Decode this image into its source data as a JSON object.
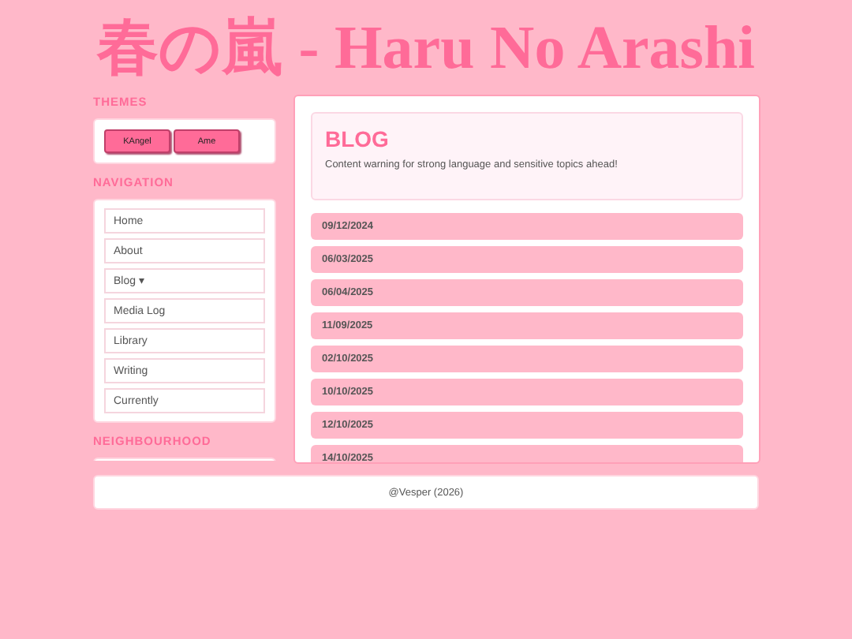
{
  "site_title": "春の嵐 - Haru No Arashi",
  "sidebar": {
    "themes_heading": "THEMES",
    "themes": [
      {
        "label": "KAngel"
      },
      {
        "label": "Ame"
      }
    ],
    "navigation_heading": "NAVIGATION",
    "navigation": [
      {
        "label": "Home"
      },
      {
        "label": "About"
      },
      {
        "label": "Blog ▾"
      },
      {
        "label": "Media Log"
      },
      {
        "label": "Library"
      },
      {
        "label": "Writing"
      },
      {
        "label": "Currently"
      }
    ],
    "neighbourhood_heading": "NEIGHBOURHOOD"
  },
  "blog": {
    "title": "BLOG",
    "warning": "Content warning for strong language and sensitive topics ahead!",
    "entries": [
      "09/12/2024",
      "06/03/2025",
      "06/04/2025",
      "11/09/2025",
      "02/10/2025",
      "10/10/2025",
      "12/10/2025",
      "14/10/2025"
    ]
  },
  "footer": "@Vesper (2026)"
}
